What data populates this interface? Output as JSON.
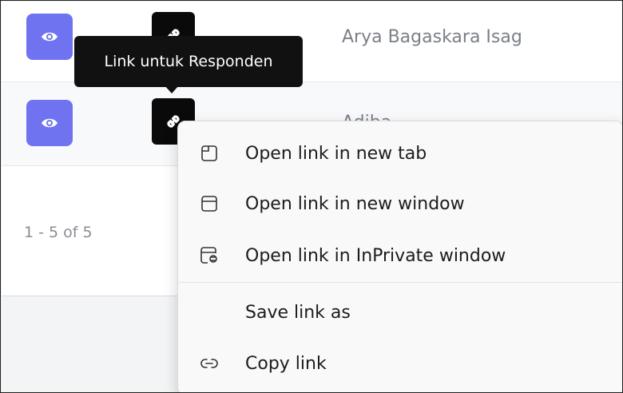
{
  "table": {
    "rows": [
      {
        "name": "Arya Bagaskara Isag",
        "view_icon": "eye-icon",
        "link_icon": "link-icon"
      },
      {
        "name": "Adiba",
        "view_icon": "eye-icon",
        "link_icon": "link-icon"
      }
    ],
    "pagination": "1 - 5 of 5"
  },
  "tooltip": {
    "text": "Link untuk Responden"
  },
  "context_menu": {
    "items": [
      {
        "label": "Open link in new tab",
        "icon": "new-tab-icon"
      },
      {
        "label": "Open link in new window",
        "icon": "new-window-icon"
      },
      {
        "label": "Open link in InPrivate window",
        "icon": "inprivate-window-icon"
      },
      {
        "label": "Save link as",
        "icon": ""
      },
      {
        "label": "Copy link",
        "icon": "copy-link-icon"
      }
    ]
  },
  "colors": {
    "view_button": "#6f73f0",
    "link_button": "#0a0a0a",
    "tooltip_bg": "#111111",
    "menu_bg": "#f9f9f9"
  }
}
